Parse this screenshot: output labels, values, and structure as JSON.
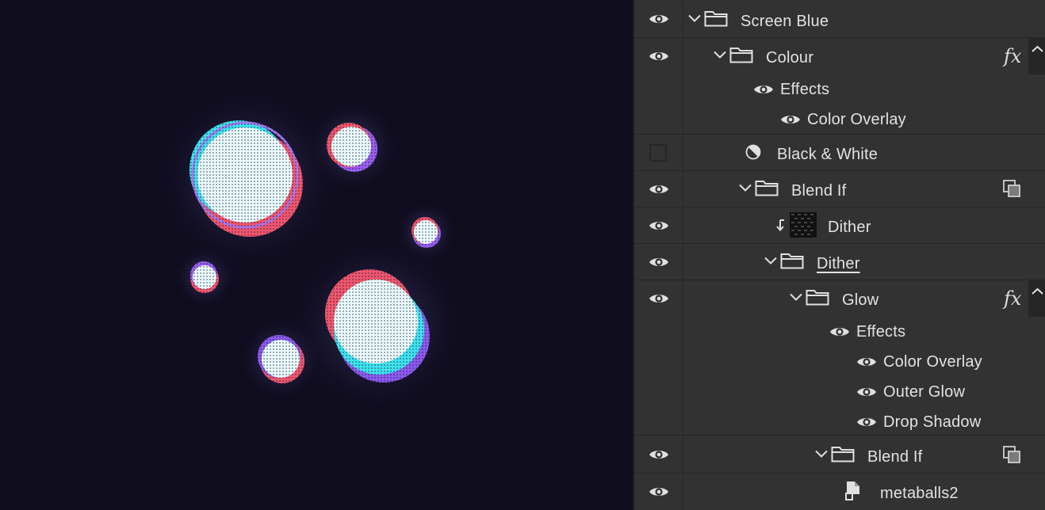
{
  "colors": {
    "canvas_bg": "#0f0c1e",
    "panel_bg": "#323232",
    "divider": "#262626",
    "text": "#e2e2e2",
    "cyan": "#3fe3f0",
    "pink": "#f0576e",
    "purple": "#8c5bf0"
  },
  "layers": [
    {
      "id": "screen_blue",
      "label": "Screen Blue",
      "type": "group",
      "visible": true,
      "icons": [
        "eye-icon",
        "chevron-down-icon",
        "folder-icon"
      ]
    },
    {
      "id": "colour",
      "label": "Colour",
      "type": "group",
      "visible": true,
      "fx": "fx",
      "effects": {
        "label": "Effects",
        "items": [
          "Color Overlay"
        ]
      }
    },
    {
      "id": "black_white",
      "label": "Black & White",
      "type": "adjustment",
      "visible": false,
      "icons": [
        "adjustment-half-circle-icon"
      ]
    },
    {
      "id": "blend_if_1",
      "label": "Blend If",
      "type": "group",
      "visible": true,
      "badge": "mask-icon"
    },
    {
      "id": "dither_layer",
      "label": "Dither",
      "type": "clipped-pattern",
      "visible": true,
      "icons": [
        "clip-arrow-icon",
        "pattern-thumbnail-icon"
      ]
    },
    {
      "id": "dither_group",
      "label": "Dither",
      "type": "group",
      "visible": true,
      "editing": true
    },
    {
      "id": "glow",
      "label": "Glow",
      "type": "group",
      "visible": true,
      "fx": "fx",
      "effects": {
        "label": "Effects",
        "items": [
          "Color Overlay",
          "Outer Glow",
          "Drop Shadow"
        ]
      }
    },
    {
      "id": "blend_if_2",
      "label": "Blend If",
      "type": "group",
      "visible": true,
      "badge": "mask-icon"
    },
    {
      "id": "metaballs",
      "label": "metaballs2",
      "type": "smart-object",
      "visible": true,
      "icons": [
        "smart-object-icon"
      ]
    }
  ]
}
